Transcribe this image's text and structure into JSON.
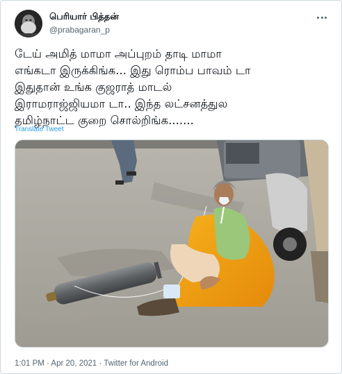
{
  "tweet": {
    "display_name": "பெரியார் பித்தன்",
    "handle": "@prabagaran_p",
    "text": "டேய் அமித் மாமா அப்புறம் தாடி மாமா\nஎங்கடா இருக்கிங்க... இது ரொம்ப பாவம் டா\nஇதுதான் உங்க குஜராத் மாடல்\nஇராமராஜ்ஜியமா டா.. இந்த லட்சனத்துல\nதமிழ்நாட்ட குறை சொல்றிங்க.......",
    "translate_label": "Translate Tweet",
    "time": "1:01 PM",
    "separator1": " · ",
    "date": "Apr 20, 2021",
    "separator2": " · ",
    "source": "Twitter for Android"
  },
  "icons": {
    "more": "more-horizontal-icon"
  },
  "colors": {
    "accent": "#1d9bf0",
    "secondary_text": "#536471",
    "border": "#cfd9de"
  }
}
